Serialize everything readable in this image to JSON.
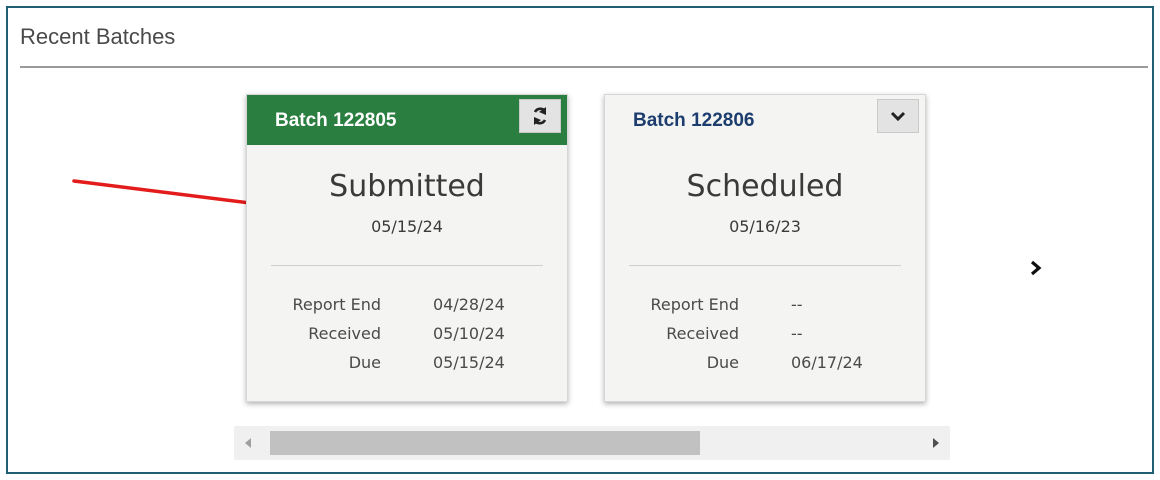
{
  "section": {
    "title": "Recent Batches"
  },
  "cards": [
    {
      "title": "Batch 122805",
      "header_style": "green",
      "header_button_icon": "refresh-icon",
      "status": "Submitted",
      "status_date": "05/15/24",
      "details": [
        {
          "label": "Report End",
          "value": "04/28/24"
        },
        {
          "label": "Received",
          "value": "05/10/24"
        },
        {
          "label": "Due",
          "value": "05/15/24"
        }
      ]
    },
    {
      "title": "Batch 122806",
      "header_style": "plain",
      "header_button_icon": "chevron-down-icon",
      "status": "Scheduled",
      "status_date": "05/16/23",
      "details": [
        {
          "label": "Report End",
          "value": "--"
        },
        {
          "label": "Received",
          "value": "--"
        },
        {
          "label": "Due",
          "value": "06/17/24"
        }
      ]
    }
  ],
  "navigation": {
    "next_icon": "chevron-right-icon"
  },
  "colors": {
    "panel_border": "#1f5e73",
    "submitted_header": "#2a7e3f",
    "scheduled_title": "#1c3d6e",
    "annotation_arrow": "#e31b1b"
  }
}
